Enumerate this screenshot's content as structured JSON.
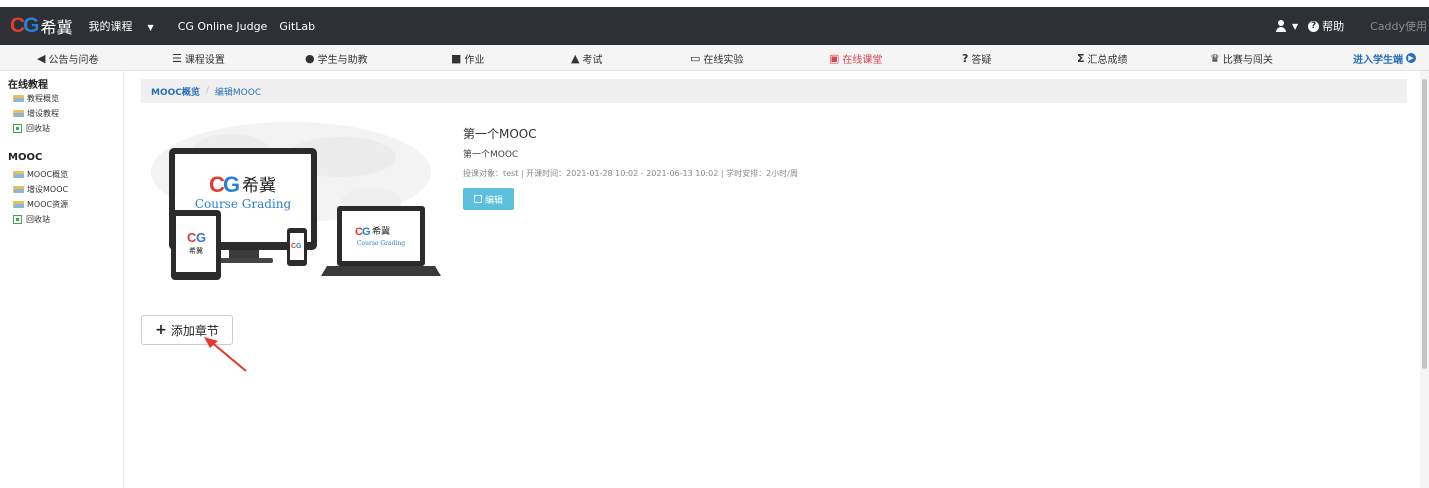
{
  "topbar": {
    "logo_text": "希冀",
    "nav": [
      "我的课程",
      "CG Online Judge",
      "GitLab"
    ],
    "help": "帮助",
    "user": "Caddy使用"
  },
  "subnav": {
    "items": [
      {
        "icon": "megaphone-icon",
        "label": "公告与问卷"
      },
      {
        "icon": "list-icon",
        "label": "课程设置"
      },
      {
        "icon": "users-icon",
        "label": "学生与助教"
      },
      {
        "icon": "homework-icon",
        "label": "作业"
      },
      {
        "icon": "exam-icon",
        "label": "考试"
      },
      {
        "icon": "monitor-icon",
        "label": "在线实验"
      },
      {
        "icon": "classroom-icon",
        "label": "在线课堂"
      },
      {
        "icon": "question-icon",
        "label": "答疑"
      },
      {
        "icon": "sigma-icon",
        "label": "汇总成绩"
      },
      {
        "icon": "trophy-icon",
        "label": "比赛与闯关"
      }
    ],
    "active": "在线课堂",
    "enter": "进入学生端"
  },
  "sidebar": {
    "group1": "在线教程",
    "group1_items": [
      "教程概览",
      "增设教程",
      "回收站"
    ],
    "group2": "MOOC",
    "group2_items": [
      "MOOC概览",
      "增设MOOC",
      "MOOC资源",
      "回收站"
    ]
  },
  "breadcrumb": {
    "item1": "MOOC概览",
    "sep": "/",
    "item2": "编辑MOOC"
  },
  "course": {
    "image_logo": "希冀",
    "image_caption": "Course Grading",
    "title": "第一个MOOC",
    "subtitle": "第一个MOOC",
    "meta": "授课对象：test | 开课时间：2021-01-28 10:02 - 2021-06-13 10:02 | 学时安排：2小时/周",
    "edit": "编辑"
  },
  "add_chapter": "添加章节",
  "colors": {
    "topbar": "#2d3035",
    "active": "#d9434f",
    "link": "#2a6fb8",
    "edit_button": "#5bc0de"
  }
}
